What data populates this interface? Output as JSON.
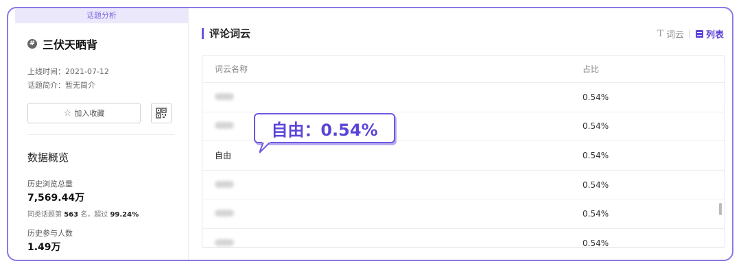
{
  "left": {
    "tab_label": "话题分析",
    "topic_icon": "#",
    "topic_title": "三伏天晒背",
    "launch_time_label": "上线时间：",
    "launch_time": "2021-07-12",
    "intro_label": "话题简介：",
    "intro": "暂无简介",
    "favorite_label": "加入收藏",
    "overview_title": "数据概览",
    "stats": [
      {
        "label": "历史浏览总量",
        "value": "7,569.44万",
        "rank_prefix": "同类话题第",
        "rank": "563",
        "rank_mid": "名，超过",
        "percent": "99.24%"
      },
      {
        "label": "历史参与人数",
        "value": "1.49万"
      }
    ]
  },
  "right": {
    "title": "评论词云",
    "toggle_word": "词云",
    "toggle_list": "列表",
    "columns": {
      "name": "词云名称",
      "pct": "占比"
    },
    "rows": [
      {
        "name": "",
        "pct": "0.54%",
        "blurred": true
      },
      {
        "name": "",
        "pct": "0.54%",
        "blurred": true
      },
      {
        "name": "自由",
        "pct": "0.54%",
        "blurred": false
      },
      {
        "name": "",
        "pct": "0.54%",
        "blurred": true
      },
      {
        "name": "",
        "pct": "0.54%",
        "blurred": true
      },
      {
        "name": "",
        "pct": "0.54%",
        "blurred": true
      }
    ],
    "callout": "自由：0.54%"
  },
  "colors": {
    "accent": "#6b54e0",
    "frame": "#8b78e6",
    "tab_bg": "#ece8fc"
  }
}
